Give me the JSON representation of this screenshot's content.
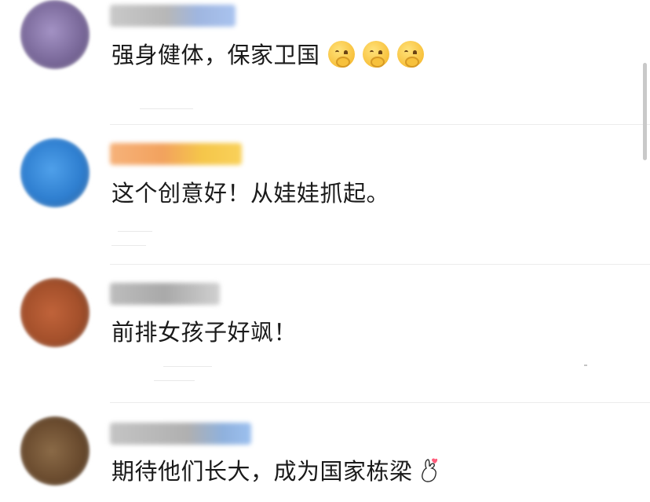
{
  "comments": [
    {
      "text": "强身健体，保家卫国",
      "emoji": [
        "blushing-face",
        "blushing-face",
        "blushing-face"
      ],
      "avatar_color": "#8a7aa8",
      "username_color": "#9aa7c6"
    },
    {
      "text": "这个创意好！从娃娃抓起。",
      "emoji": [],
      "avatar_color": "#3b86d4",
      "username_color": "#f2a54a"
    },
    {
      "text": "前排女孩子好飒！",
      "emoji": [],
      "avatar_color": "#a8552e",
      "username_color": "#8c8c8c"
    },
    {
      "text": "期待他们长大，成为国家栋梁",
      "emoji": [
        "finger-heart-hand"
      ],
      "avatar_color": "#6b4c2f",
      "username_color": "#8fb1dd"
    }
  ],
  "colors": {
    "text": "#1a1a1a",
    "divider": "#ececec",
    "scrollbar": "#c9c9c9"
  }
}
